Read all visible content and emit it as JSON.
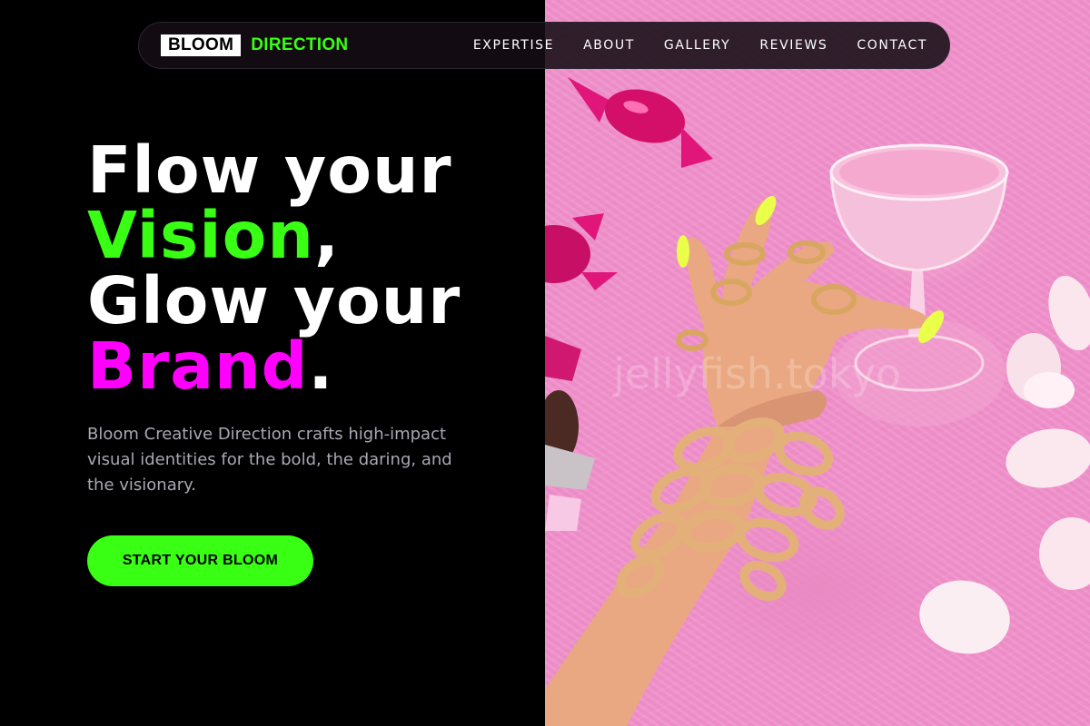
{
  "brand": {
    "word1": "BLOOM",
    "word2": "DIRECTION"
  },
  "nav": {
    "items": [
      "EXPERTISE",
      "ABOUT",
      "GALLERY",
      "REVIEWS",
      "CONTACT"
    ]
  },
  "hero": {
    "line1": "Flow your",
    "line2_highlight": "Vision",
    "line2_punct": ",",
    "line3": "Glow your",
    "line4_highlight": "Brand",
    "line4_punct": ".",
    "description": "Bloom Creative Direction crafts high-impact visual identities for the bold, the daring, and the visionary.",
    "cta_label": "START YOUR BLOOM"
  },
  "photo": {
    "watermark": "jellyfish.tokyo"
  },
  "colors": {
    "accent_green": "#39ff14",
    "accent_magenta": "#ff00ff",
    "background": "#000000",
    "photo_pink": "#ee8fc9"
  }
}
